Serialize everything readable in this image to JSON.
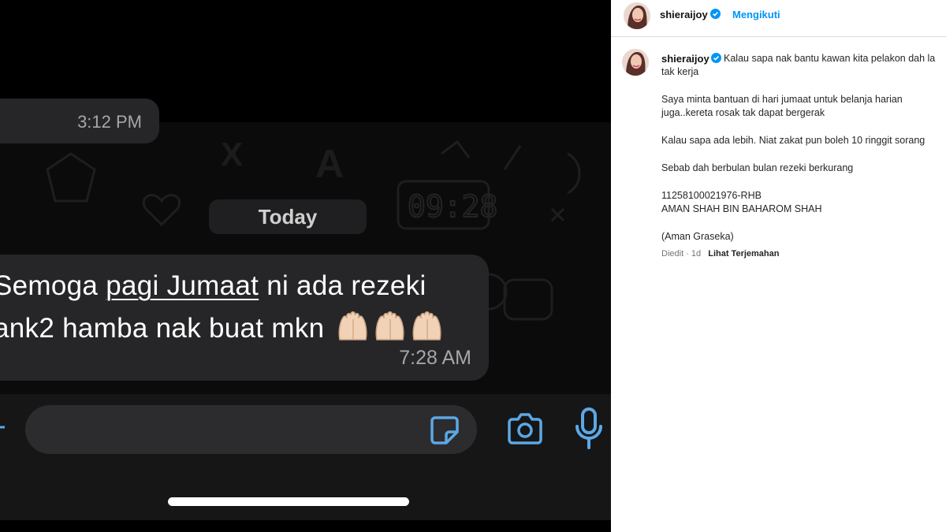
{
  "chat": {
    "prev_time": "3:12 PM",
    "date_divider": "Today",
    "message": {
      "line1_pre": "Semoga ",
      "line1_underlined": "pagi Jumaat",
      "line1_post": " ni ada rezeki",
      "line2": "ank2 hamba nak buat mkn",
      "emoji": "🤲🤲🤲",
      "time": "7:28 AM"
    },
    "icons": [
      "plus-icon",
      "sticker-icon",
      "camera-icon",
      "microphone-icon"
    ],
    "accent_color": "#5ba8e6"
  },
  "instagram": {
    "username": "shieraijoy",
    "follow_label": "Mengikuti",
    "caption": {
      "line1": "Kalau sapa nak bantu kawan kita pelakon dah la",
      "line1b": "tak kerja",
      "p2_line1": "Saya minta bantuan di hari jumaat untuk belanja harian",
      "p2_line2": "juga..kereta rosak tak dapat bergerak",
      "p3": "Kalau sapa ada lebih. Niat zakat pun boleh 10 ringgit sorang",
      "p4": "Sebab dah berbulan bulan rezeki berkurang",
      "account": "11258100021976-RHB",
      "account_name": "AMAN SHAH BIN BAHAROM SHAH",
      "alias": "(Aman Graseka)"
    },
    "meta": {
      "edited": "Diedit",
      "age": "· 1d",
      "translate": "Lihat Terjemahan"
    },
    "colors": {
      "link": "#0095f6",
      "verified": "#0095f6"
    }
  }
}
